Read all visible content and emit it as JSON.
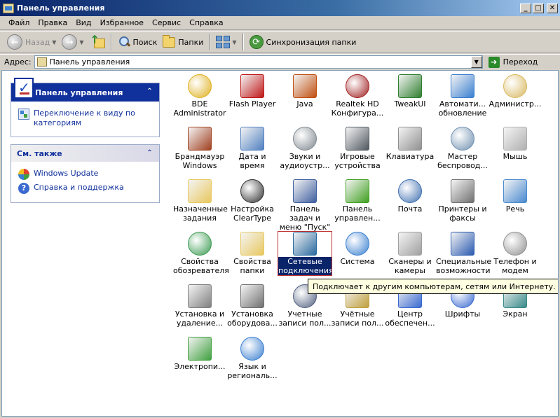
{
  "window": {
    "title": "Панель управления"
  },
  "menu": [
    "Файл",
    "Правка",
    "Вид",
    "Избранное",
    "Сервис",
    "Справка"
  ],
  "toolbar": {
    "back": "Назад",
    "search": "Поиск",
    "folders": "Папки",
    "sync": "Синхронизация папки"
  },
  "address": {
    "label": "Адрес:",
    "value": "Панель управления",
    "go": "Переход"
  },
  "side": {
    "panel1": {
      "title": "Панель управления",
      "link": "Переключение к виду по категориям"
    },
    "panel2": {
      "title": "См. также",
      "links": [
        "Windows Update",
        "Справка и поддержка"
      ]
    }
  },
  "items": [
    {
      "label": "BDE Administrator",
      "color": "#e0b020"
    },
    {
      "label": "Flash Player",
      "color": "#c01818"
    },
    {
      "label": "Java",
      "color": "#c05010"
    },
    {
      "label": "Realtek HD Конфигура...",
      "color": "#a02020"
    },
    {
      "label": "TweakUI",
      "color": "#308030"
    },
    {
      "label": "Автомати... обновление",
      "color": "#3a7fd0"
    },
    {
      "label": "Администр...",
      "color": "#d8b860"
    },
    {
      "label": "Брандмауэр Windows",
      "color": "#a04020"
    },
    {
      "label": "Дата и время",
      "color": "#5080c0"
    },
    {
      "label": "Звуки и аудиоустр...",
      "color": "#808890"
    },
    {
      "label": "Игровые устройства",
      "color": "#505860"
    },
    {
      "label": "Клавиатура",
      "color": "#909090"
    },
    {
      "label": "Мастер беспровод...",
      "color": "#7090b0"
    },
    {
      "label": "Мышь",
      "color": "#b0b0b0"
    },
    {
      "label": "Назначенные задания",
      "color": "#e8c860"
    },
    {
      "label": "Настройка ClearType",
      "color": "#303030"
    },
    {
      "label": "Панель задач и меню \"Пуск\"",
      "color": "#4060a0"
    },
    {
      "label": "Панель управлен...",
      "color": "#40a020"
    },
    {
      "label": "Почта",
      "color": "#4070b0"
    },
    {
      "label": "Принтеры и факсы",
      "color": "#707070"
    },
    {
      "label": "Речь",
      "color": "#4a8ad0"
    },
    {
      "label": "Свойства обозревателя",
      "color": "#3a9a50"
    },
    {
      "label": "Свойства папки",
      "color": "#e8c860"
    },
    {
      "label": "Сетевые подключения",
      "color": "#2a6aa0"
    },
    {
      "label": "Система",
      "color": "#3a7fd0"
    },
    {
      "label": "Сканеры и камеры",
      "color": "#a0a0a0"
    },
    {
      "label": "Специальные возможности",
      "color": "#2a5ab0"
    },
    {
      "label": "Телефон и модем",
      "color": "#909090"
    },
    {
      "label": "Установка и удаление...",
      "color": "#808080"
    },
    {
      "label": "Установка оборудова...",
      "color": "#707070"
    },
    {
      "label": "Учетные записи пол...",
      "color": "#506080"
    },
    {
      "label": "Учётные записи пол...",
      "color": "#c0a040"
    },
    {
      "label": "Центр обеспечен...",
      "color": "#3a6ad0"
    },
    {
      "label": "Шрифты",
      "color": "#3a6ad0"
    },
    {
      "label": "Экран",
      "color": "#3a8a8a"
    },
    {
      "label": "Электропи...",
      "color": "#40a040"
    },
    {
      "label": "Язык и региональ...",
      "color": "#3a7fd0"
    }
  ],
  "tooltip": "Подключает к другим компьютерам, сетям или Интернету."
}
